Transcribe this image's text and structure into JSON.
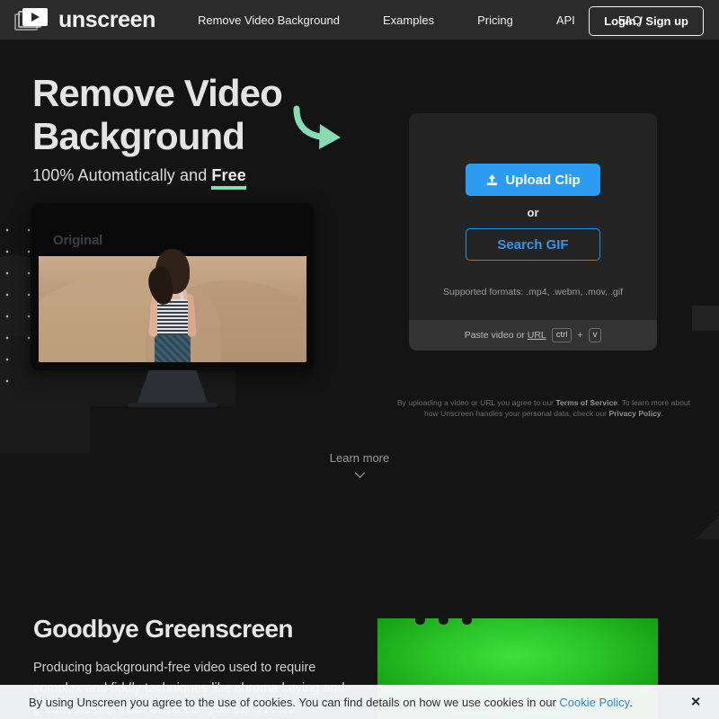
{
  "header": {
    "logo_text": "unscreen",
    "nav": [
      {
        "label": "Remove Video Background"
      },
      {
        "label": "Examples"
      },
      {
        "label": "Pricing"
      },
      {
        "label": "API"
      },
      {
        "label": "FAQ"
      }
    ],
    "login_label": "Login / Sign up"
  },
  "hero": {
    "headline": "Remove Video Background",
    "subhead_prefix": "100% Automatically and ",
    "subhead_emphasis": "Free",
    "monitor_label": "Original",
    "accent_green": "#7fe0b0"
  },
  "upload_card": {
    "upload_label": "Upload Clip",
    "or_label": "or",
    "search_gif_label": "Search GIF",
    "formats": "Supported formats: .mp4, .webm, .mov, .gif",
    "paste_prefix": "Paste video or ",
    "paste_url": "URL",
    "key_ctrl": "ctrl",
    "key_plus": "+",
    "key_v": "v",
    "primary_color": "#2b9cf0",
    "secondary_color": "#3596e8"
  },
  "legal": {
    "line1_a": "By uploading a video or URL you agree to our ",
    "line1_b": "Terms of Service",
    "line1_c": ". To learn more about",
    "line2_a": "how Unscreen handles your personal data, check our ",
    "line2_b": "Privacy Policy",
    "line2_c": "."
  },
  "learn_more": {
    "label": "Learn more"
  },
  "section2": {
    "heading": "Goodbye Greenscreen",
    "paragraph": "Producing background-free video used to require complex and fiddly techniques like chroma keying and greenscreens. With Unscreen you can record"
  },
  "cookie": {
    "text_a": "By using Unscreen you agree to the use of cookies. You can find details on how we use cookies in our ",
    "link": "Cookie Policy",
    "text_b": ".",
    "close": "✕"
  }
}
